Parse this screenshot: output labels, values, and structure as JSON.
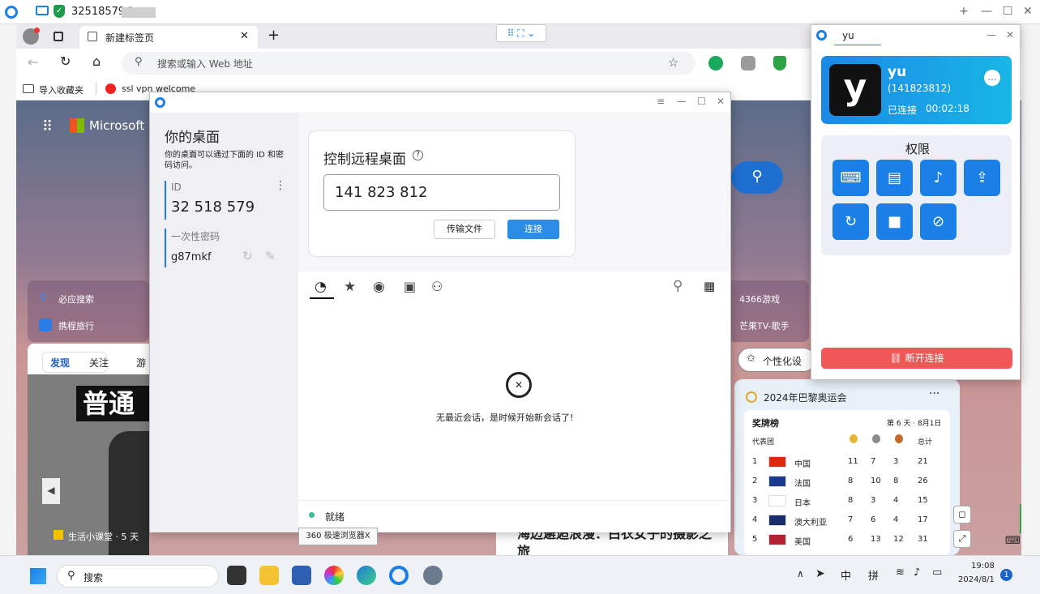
{
  "outer": {
    "title": "32518579@"
  },
  "browser": {
    "tab_label": "新建标签页",
    "address_placeholder": "搜索或输入 Web 地址",
    "bookmarks": [
      "导入收藏夹",
      "ssl vpn welcome"
    ],
    "brand": "Microsoft S",
    "quick_links": [
      "必应搜索",
      "携程旅行",
      "4366游戏",
      "芒果TV-歌手"
    ],
    "feed_tabs": [
      "发现",
      "关注",
      "游"
    ],
    "personalize": "个性化设",
    "hero_text": "普通",
    "video_meta": "生活小课堂 · 5 天",
    "news_title": "海边邂逅浪漫：白衣女子的摄影之旅",
    "tooltip": "360 极速浏览器X"
  },
  "olympics": {
    "title": "2024年巴黎奥运会",
    "board": "奖牌榜",
    "day": "第 6 天 · 8月1日",
    "col_team": "代表团",
    "col_total": "总计",
    "rows": [
      {
        "rank": "1",
        "name": "中国",
        "g": "11",
        "s": "7",
        "b": "3",
        "t": "21"
      },
      {
        "rank": "2",
        "name": "法国",
        "g": "8",
        "s": "10",
        "b": "8",
        "t": "26"
      },
      {
        "rank": "3",
        "name": "日本",
        "g": "8",
        "s": "3",
        "b": "4",
        "t": "15"
      },
      {
        "rank": "4",
        "name": "澳大利亚",
        "g": "7",
        "s": "6",
        "b": "4",
        "t": "17"
      },
      {
        "rank": "5",
        "name": "美国",
        "g": "6",
        "s": "13",
        "b": "12",
        "t": "31"
      }
    ]
  },
  "rustdesk": {
    "your_desktop": "你的桌面",
    "desc": "你的桌面可以通过下面的 ID 和密码访问。",
    "id_label": "ID",
    "id_value": "32 518 579",
    "pw_label": "一次性密码",
    "pw_value": "g87mkf",
    "control_title": "控制远程桌面",
    "remote_id": "141 823 812",
    "transfer_btn": "传输文件",
    "connect_btn": "连接",
    "empty_msg": "无最近会话，是时候开始新会话了!",
    "status": "就绪"
  },
  "cm": {
    "tab_name": "yu",
    "name": "yu",
    "id": "(141823812)",
    "status": "已连接",
    "duration": "00:02:18",
    "avatar_letter": "y",
    "perm_title": "权限",
    "disconnect": "断开连接"
  },
  "taskbar": {
    "search": "搜索",
    "ime1": "中",
    "ime2": "拼",
    "time": "19:08",
    "date": "2024/8/1",
    "notif": "1"
  },
  "colors": {
    "accent": "#1a7fe6",
    "danger": "#f25757"
  }
}
